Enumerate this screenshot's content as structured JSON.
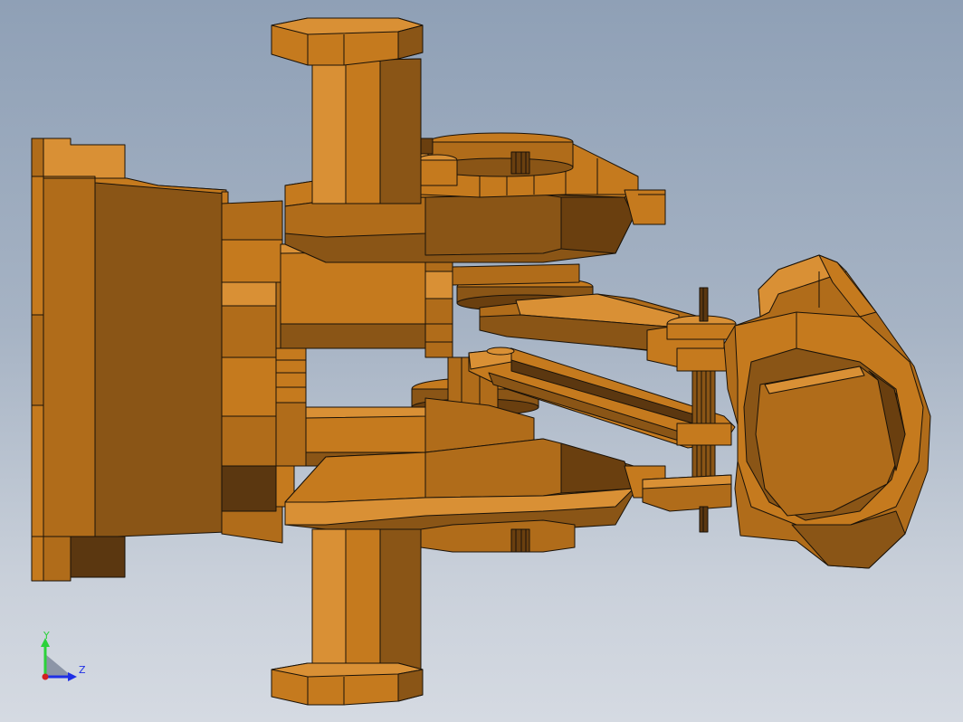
{
  "viewport": {
    "background_top": "#8fa0b6",
    "background_bottom": "#d5dae2"
  },
  "model": {
    "part_color": "#c57a1e",
    "part_mid": "#8a5516",
    "part_dark": "#6a3f0f",
    "part_light": "#d99035",
    "edge_color": "#1a1208"
  },
  "triad": {
    "y_label": "Y",
    "z_label": "Z",
    "y_color": "#2bd23a",
    "z_color": "#1f2fe6",
    "origin_color": "#d41f1f"
  }
}
